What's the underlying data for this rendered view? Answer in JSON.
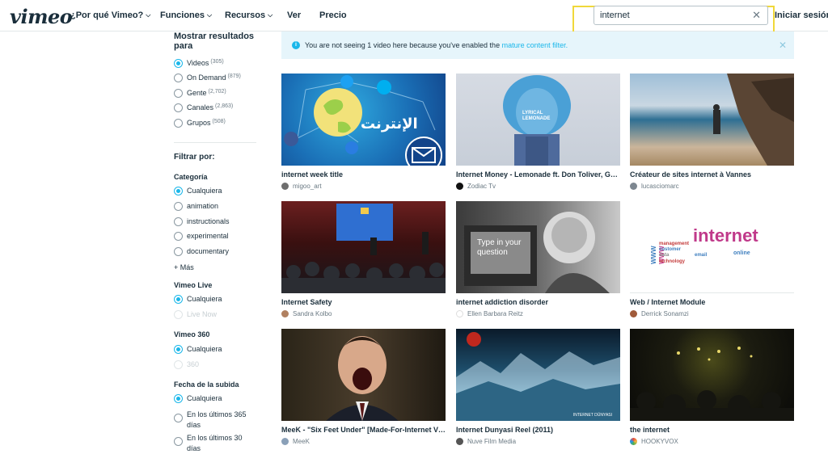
{
  "header": {
    "logo": "vimeo",
    "nav": [
      {
        "label": "¿Por qué Vimeo?",
        "chevron": true
      },
      {
        "label": "Funciones",
        "chevron": true
      },
      {
        "label": "Recursos",
        "chevron": true
      },
      {
        "label": "Ver",
        "chevron": false
      },
      {
        "label": "Precio",
        "chevron": false
      }
    ],
    "search_value": "internet",
    "signin": "Iniciar sesión"
  },
  "sidebar": {
    "show_results_title": "Mostrar resultados para",
    "types": [
      {
        "label": "Videos",
        "count": "(305)",
        "selected": true
      },
      {
        "label": "On Demand",
        "count": "(879)",
        "selected": false
      },
      {
        "label": "Gente",
        "count": "(2,702)",
        "selected": false
      },
      {
        "label": "Canales",
        "count": "(2,863)",
        "selected": false
      },
      {
        "label": "Grupos",
        "count": "(508)",
        "selected": false
      }
    ],
    "filter_title": "Filtrar por:",
    "category": {
      "title": "Categoría",
      "options": [
        "Cualquiera",
        "animation",
        "instructionals",
        "experimental",
        "documentary"
      ],
      "selected": 0,
      "more": "+ Más"
    },
    "live": {
      "title": "Vimeo Live",
      "options": [
        "Cualquiera",
        "Live Now"
      ],
      "selected": 0
    },
    "v360": {
      "title": "Vimeo 360",
      "options": [
        "Cualquiera",
        "360"
      ],
      "selected": 0
    },
    "upload_date": {
      "title": "Fecha de la subida",
      "options": [
        "Cualquiera",
        "En los últimos 365 días",
        "En los últimos 30 días"
      ],
      "selected": 0
    }
  },
  "notice": {
    "text": "You are not seeing 1 video here because you've enabled the",
    "link": "mature content filter."
  },
  "videos": [
    {
      "title": "internet week title",
      "author": "migoo_art",
      "thumb_label": "الإنترنت"
    },
    {
      "title": "Internet Money - Lemonade ft. Don Toliver, Gu...",
      "author": "Zodiac Tv",
      "thumb_label": "LYRICAL LEMONADE"
    },
    {
      "title": "Créateur de sites internet à Vannes",
      "author": "lucasciomarc",
      "thumb_label": ""
    },
    {
      "title": "Internet Safety",
      "author": "Sandra Kolbo",
      "thumb_label": ""
    },
    {
      "title": "internet addiction disorder",
      "author": "Ellen Barbara Reitz",
      "thumb_label": "Type in your question"
    },
    {
      "title": "Web / Internet Module",
      "author": "Derrick Sonamzi",
      "thumb_label": "internet"
    },
    {
      "title": "MeeK - \"Six Feet Under\" [Made-For-Internet Vi...",
      "author": "MeeK",
      "thumb_label": ""
    },
    {
      "title": "Internet Dunyasi Reel (2011)",
      "author": "Nuve Film Media",
      "thumb_label": "INTERNET DÜNYASI"
    },
    {
      "title": "the internet",
      "author": "HOOKYVOX",
      "thumb_label": ""
    }
  ]
}
